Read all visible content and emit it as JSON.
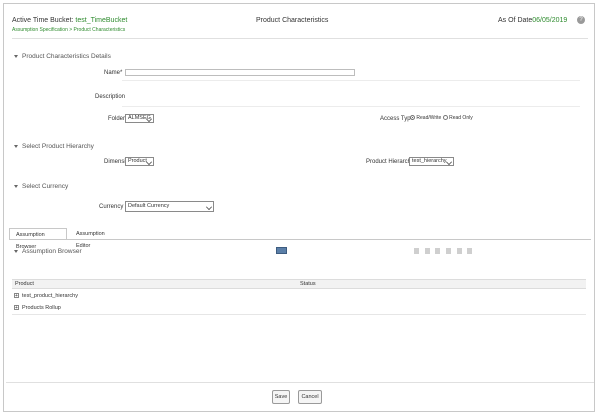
{
  "header": {
    "active_bucket_label": "Active Time Bucket:",
    "active_bucket_value": "test_TimeBucket",
    "breadcrumb": "Assumption Specification > Product Characteristics",
    "page_title": "Product Characteristics",
    "as_of_label": "As Of Date",
    "as_of_value": "06/05/2019",
    "help_icon": "question-circle-icon"
  },
  "details": {
    "section_title": "Product Characteristics Details",
    "name_label": "Name*",
    "name_value": "",
    "description_label": "Description",
    "folder_label": "Folder",
    "folder_value": "ALMSEG",
    "access_type_label": "Access Type",
    "access_options": [
      "Read/Write",
      "Read Only"
    ],
    "access_selected": "Read/Write"
  },
  "hierarchy": {
    "section_title": "Select Product Hierarchy",
    "dimension_label": "Dimension",
    "dimension_value": "Product",
    "hierarchy_label": "Product Hierarchy",
    "hierarchy_value": "test_hierarchy"
  },
  "currency": {
    "section_title": "Select Currency",
    "currency_label": "Currency",
    "currency_value": "Default Currency"
  },
  "tabs": [
    {
      "label": "Assumption Browser",
      "active": true
    },
    {
      "label": "Assumption Editor",
      "active": false
    }
  ],
  "browser": {
    "title": "Assumption Browser",
    "columns": [
      "Product",
      "Status"
    ],
    "rows": [
      {
        "label": "test_product_hierarchy",
        "status": ""
      },
      {
        "label": "Products Rollup",
        "status": ""
      }
    ]
  },
  "buttons": {
    "save": "Save",
    "cancel": "Cancel"
  }
}
